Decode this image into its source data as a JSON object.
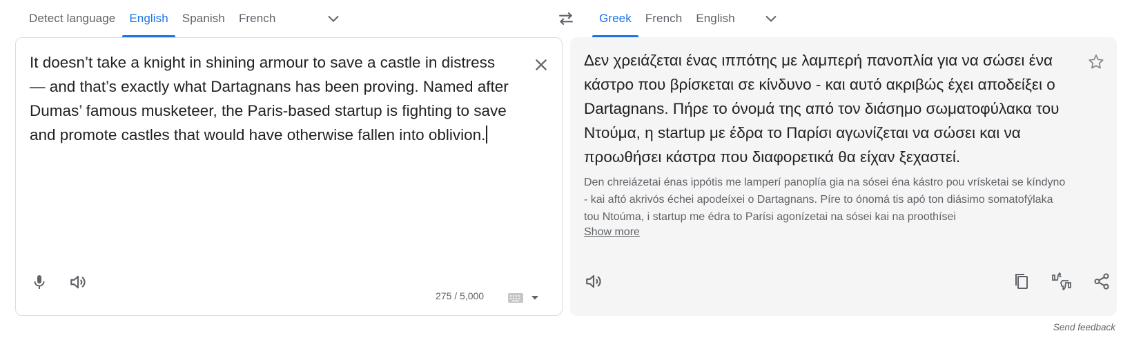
{
  "source_languages": {
    "tabs": [
      {
        "label": "Detect language",
        "active": false
      },
      {
        "label": "English",
        "active": true
      },
      {
        "label": "Spanish",
        "active": false
      },
      {
        "label": "French",
        "active": false
      }
    ],
    "more_icon": "chevron-down-icon"
  },
  "target_languages": {
    "tabs": [
      {
        "label": "Greek",
        "active": true
      },
      {
        "label": "French",
        "active": false
      },
      {
        "label": "English",
        "active": false
      }
    ],
    "more_icon": "chevron-down-icon"
  },
  "swap_icon": "swap-arrows-icon",
  "source": {
    "text": "It doesn’t take a knight in shining armour to save a castle in distress — and that’s exactly what Dartagnans has been proving. Named after Dumas’ famous musketeer, the Paris-based startup is fighting to save and promote castles that would have otherwise fallen into oblivion.",
    "char_count": "275 / 5,000",
    "icons": [
      "close-icon",
      "microphone-icon",
      "speaker-icon",
      "keyboard-icon",
      "dropdown-arrow-icon"
    ]
  },
  "target": {
    "text": "Δεν χρειάζεται ένας ιππότης με λαμπερή πανοπλία για να σώσει ένα κάστρο που βρίσκεται σε κίνδυνο - και αυτό ακριβώς έχει αποδείξει ο Dartagnans. Πήρε το όνομά της από τον διάσημο σωματοφύλακα του Ντούμα, η startup με έδρα το Παρίσι αγωνίζεται να σώσει και να προωθήσει κάστρα που διαφορετικά θα είχαν ξεχαστεί.",
    "transliteration": "Den chreiázetai énas ippótis me lamperí panoplía gia na sósei éna kástro pou vrísketai se kíndyno - kai aftó akrivós échei apodeíxei o Dartagnans. Píre to ónomá tis apó ton diásimo somatofýlaka tou Ntoúma, i startup me édra to Parísi agonízetai na sósei kai na proothísei",
    "show_more_label": "Show more",
    "icons": [
      "star-icon",
      "speaker-icon",
      "copy-icon",
      "rate-translation-icon",
      "share-icon"
    ]
  },
  "feedback_label": "Send feedback"
}
